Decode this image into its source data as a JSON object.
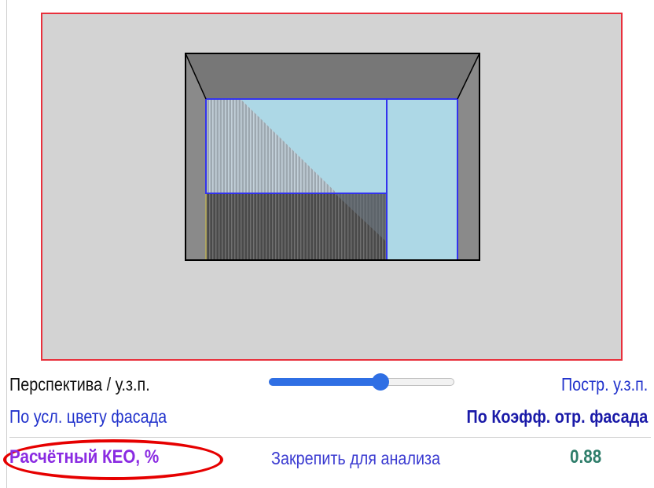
{
  "viewport": {
    "frame_color": "#e8303c",
    "background": "#d3d3d3",
    "room": {
      "outer_frame": "#000000",
      "ceiling_color": "#777777",
      "side_wall_color": "#8a8a8a",
      "floor_color": "#4f4f4f",
      "window_color": "#add8e6",
      "window_border": "#3333ee",
      "shadow_color": "#3a3a3a",
      "obstruction_outline": "#c8b84a"
    }
  },
  "controls": {
    "perspective_label": "Перспектива / у.з.п.",
    "build_label": "Постр. у.з.п.",
    "color_label": "По усл. цвету фасада",
    "coef_label": "По Коэфф. отр. фасада",
    "slider": {
      "value": 0.6,
      "accent": "#2f6fe4"
    }
  },
  "result": {
    "keo_label": "Расчётный КЕО, %",
    "lock_label": "Закрепить для анализа",
    "value": "0.88",
    "highlight_color": "#e60000"
  }
}
